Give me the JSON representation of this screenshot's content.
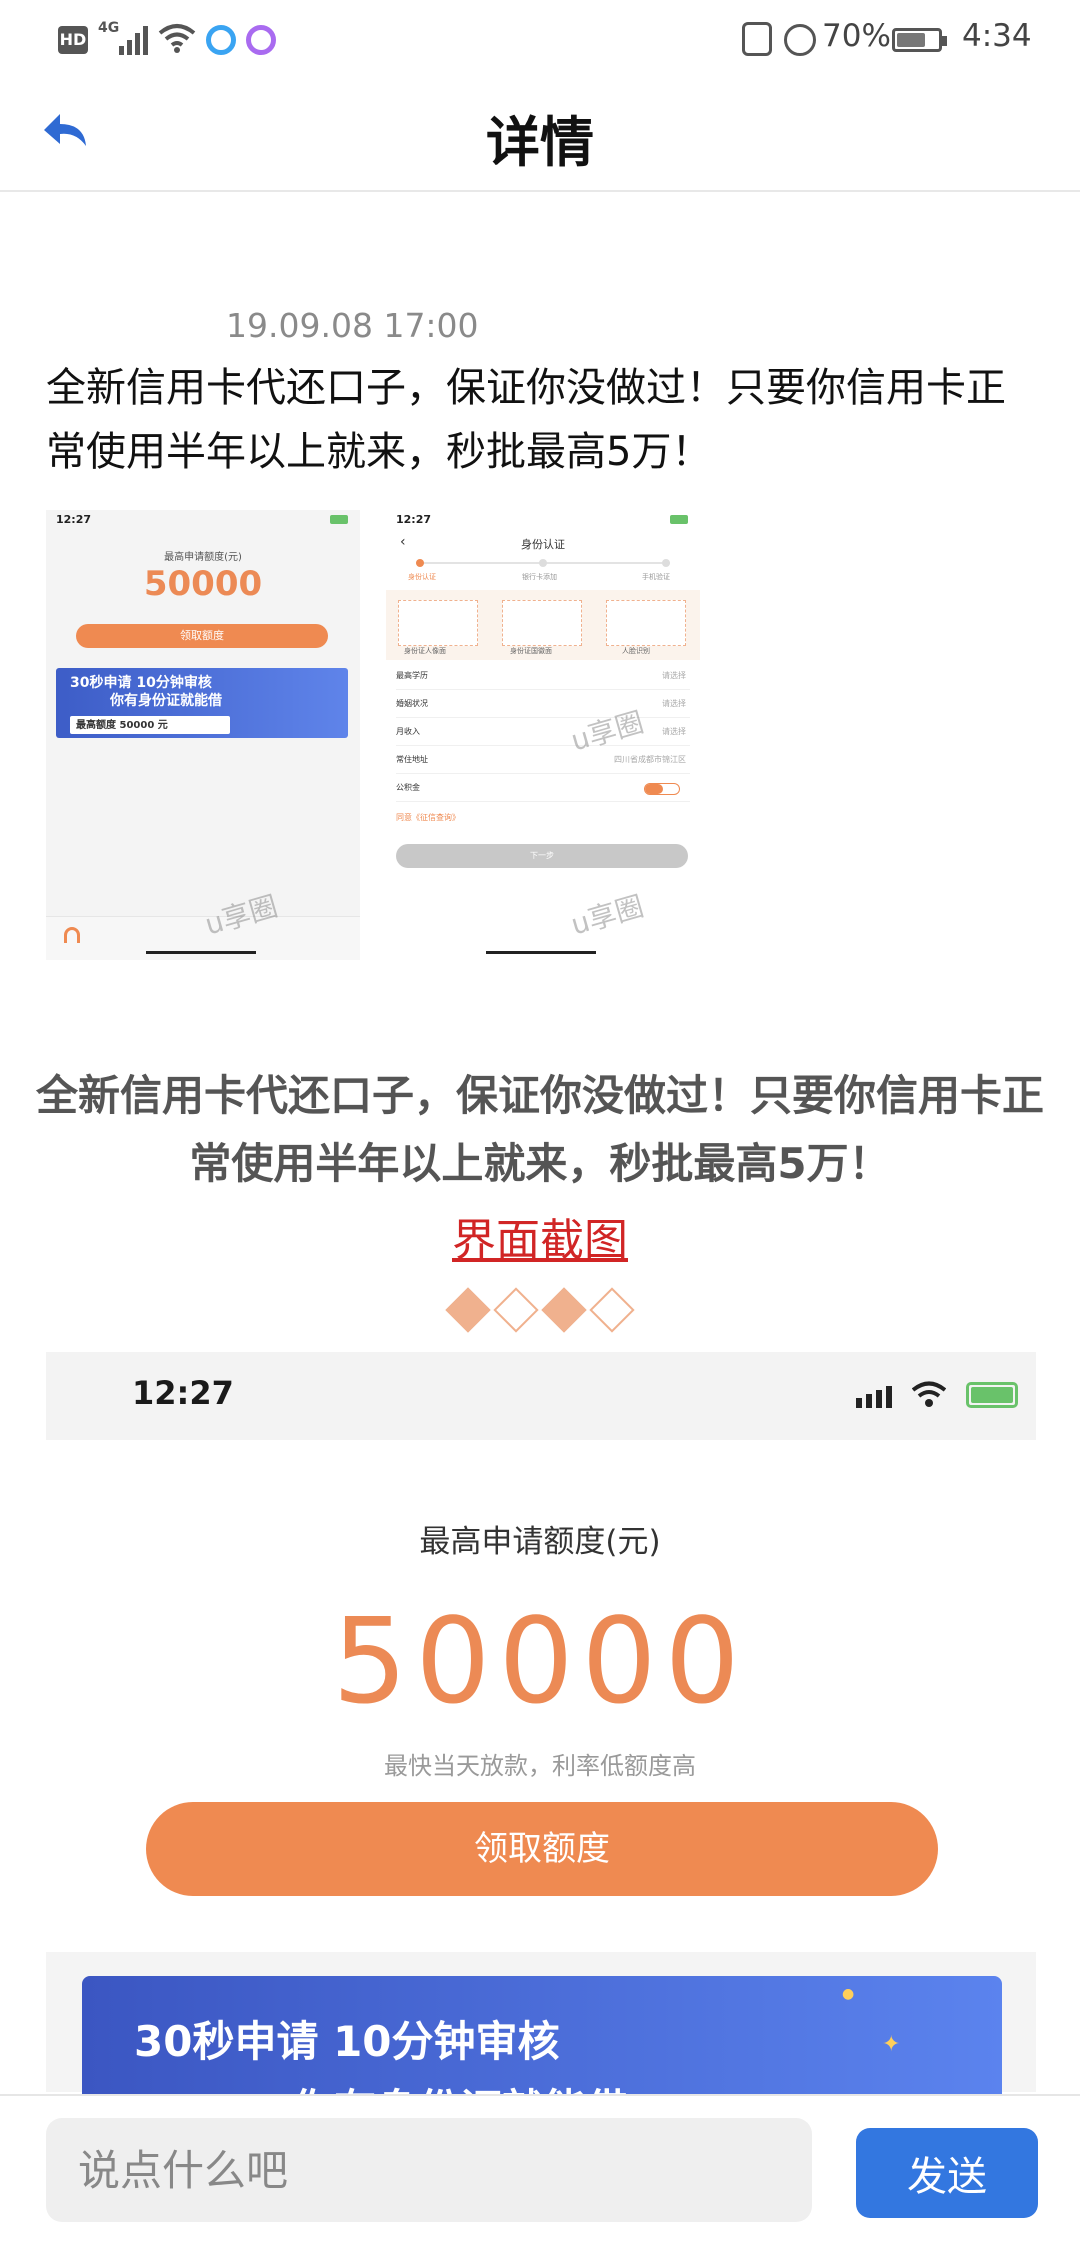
{
  "status_bar": {
    "network_label": "HD",
    "network_type": "4G",
    "battery_percent": "70%",
    "battery_level": 0.7,
    "time": "4:34"
  },
  "header": {
    "title": "详情",
    "back_icon": "back-arrow-icon"
  },
  "post": {
    "timestamp": "19.09.08 17:00",
    "text": "全新信用卡代还口子，保证你没做过！只要你信用卡正常使用半年以上就来，秒批最高5万！",
    "thumbnails": [
      {
        "status_time": "12:27",
        "amount_label": "最高申请额度(元)",
        "amount": "50000",
        "button_label": "领取额度",
        "banner_line1": "30秒申请 10分钟审核",
        "banner_line2": "你有身份证就能借",
        "banner_box": "最高额度 50000 元",
        "watermark": "u享圈"
      },
      {
        "status_time": "12:27",
        "title": "身份认证",
        "steps": [
          "身份认证",
          "银行卡添加",
          "手机验证"
        ],
        "cards": [
          "身份证人像面",
          "身份证国徽面",
          "人脸识别"
        ],
        "rows": [
          {
            "label": "最高学历",
            "value": "请选择"
          },
          {
            "label": "婚姻状况",
            "value": "请选择"
          },
          {
            "label": "月收入",
            "value": "请选择"
          },
          {
            "label": "常住地址",
            "value": "四川省成都市锦江区"
          },
          {
            "label": "公积金",
            "value": ""
          }
        ],
        "agree_text": "同意《征信查询》",
        "next_label": "下一步",
        "watermark": "u享圈"
      }
    ]
  },
  "article": {
    "headline": "全新信用卡代还口子，保证你没做过！只要你信用卡正常使用半年以上就来，秒批最高5万！",
    "link_text": "界面截图",
    "screenshot": {
      "status_time": "12:27",
      "amount_label": "最高申请额度(元)",
      "amount": "50000",
      "subtitle": "最快当天放款，利率低额度高",
      "button_label": "领取额度",
      "banner_line1": "30秒申请 10分钟审核",
      "banner_line2": "你有身份证就能借"
    }
  },
  "input_bar": {
    "placeholder": "说点什么吧",
    "send_label": "发送"
  },
  "colors": {
    "accent_orange": "#ef8a51",
    "link_red": "#d12525",
    "send_blue": "#3377e0",
    "banner_blue": "#3b56c2"
  }
}
